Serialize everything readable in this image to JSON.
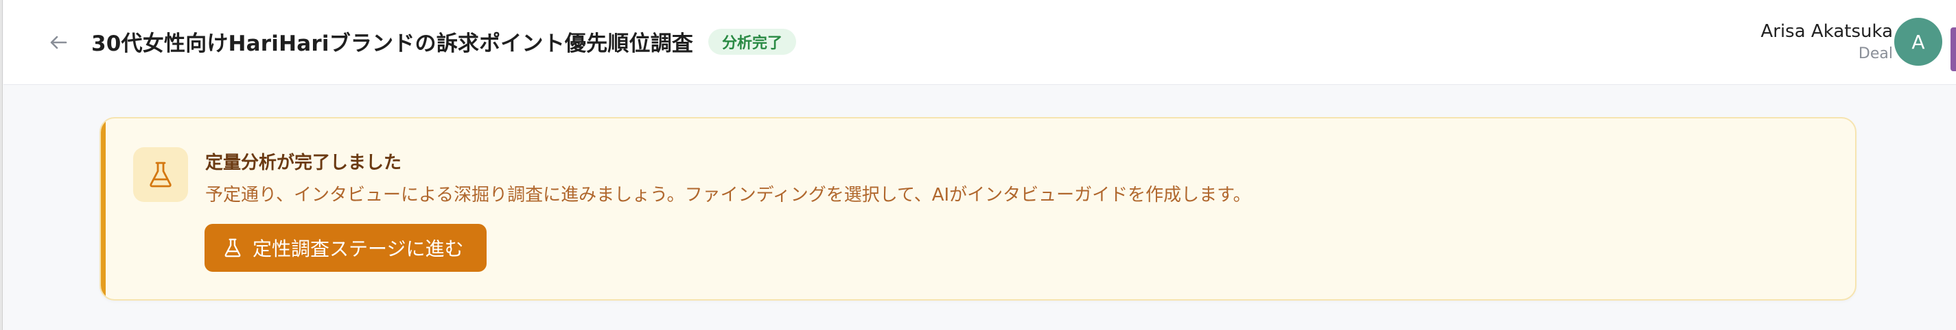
{
  "header": {
    "title": "30代女性向けHariHariブランドの訴求ポイント優先順位調査",
    "status_badge": "分析完了",
    "user": {
      "name": "Arisa Akatsuka",
      "role": "Deal",
      "avatar_initial": "A"
    }
  },
  "notice": {
    "title": "定量分析が完了しました",
    "message": "予定通り、インタビューによる深掘り調査に進みましょう。ファインディングを選択して、AIがインタビューガイドを作成します。",
    "button_label": "定性調査ステージに進む",
    "icon": "flask-icon"
  },
  "colors": {
    "accent": "#e59d1f",
    "button": "#d4770f",
    "badge_bg": "#e6f6ea",
    "badge_text": "#2a8a44",
    "avatar": "#4f9a88"
  }
}
